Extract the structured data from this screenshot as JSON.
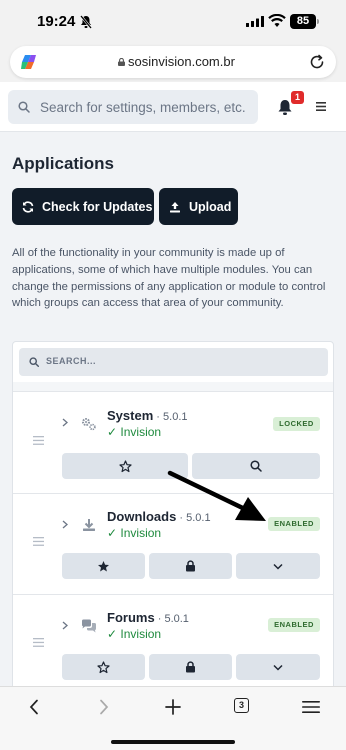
{
  "status_bar": {
    "time": "19:24",
    "battery": "85"
  },
  "browser": {
    "url": "sosinvision.com.br",
    "tab_count": "3"
  },
  "header": {
    "search_placeholder": "Search for settings, members, etc.",
    "notification_count": "1"
  },
  "page": {
    "title": "Applications",
    "buttons": {
      "check_updates": "Check for Updates",
      "upload": "Upload"
    },
    "description": "All of the functionality in your community is made up of applications, some of which have multiple modules. You can change the permissions of any application or module to control which groups can access that area of your community.",
    "filter_placeholder": "SEARCH..."
  },
  "applications": [
    {
      "name": "System",
      "version": " · 5.0.1",
      "author": "✓ Invision",
      "status": "LOCKED",
      "icon": "gears-icon",
      "actions": [
        "star-outline-icon",
        "search-icon"
      ]
    },
    {
      "name": "Downloads",
      "version": " · 5.0.1",
      "author": "✓ Invision",
      "status": "ENABLED",
      "icon": "download-icon",
      "actions": [
        "star-filled-icon",
        "lock-icon",
        "chevron-down-icon"
      ]
    },
    {
      "name": "Forums",
      "version": " · 5.0.1",
      "author": "✓ Invision",
      "status": "ENABLED",
      "icon": "chat-bubbles-icon",
      "actions": [
        "star-outline-icon",
        "lock-icon",
        "chevron-down-icon"
      ]
    }
  ],
  "colors": {
    "primary_button": "#111c29",
    "badge_bg": "#d9efd6",
    "author_green": "#1f8a3e",
    "notification_red": "#e02b2b"
  }
}
